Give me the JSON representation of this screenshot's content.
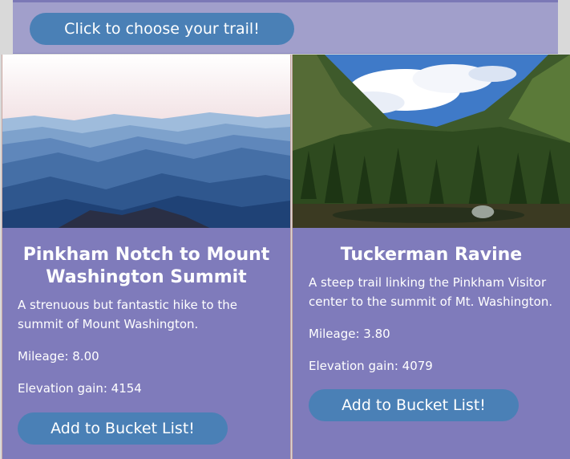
{
  "header": {
    "choose_button_label": "Click to choose your trail!"
  },
  "trails": [
    {
      "title": "Pinkham Notch to Mount Washington Summit",
      "description": "A strenuous but fantastic hike to the summit of Mount Washington.",
      "mileage": "Mileage: 8.00",
      "elevation": "Elevation gain: 4154",
      "button_label": "Add to Bucket List!",
      "image": "blue-mountain-ridges-photo"
    },
    {
      "title": "Tuckerman Ravine",
      "description": "A steep trail linking the Pinkham Visitor center to the summit of Mt. Washington.",
      "mileage": "Mileage: 3.80",
      "elevation": "Elevation gain: 4079",
      "button_label": "Add to Bucket List!",
      "image": "forested-ravine-photo"
    }
  ],
  "colors": {
    "page_background": "#d9d9d9",
    "header_background": "#a19fcb",
    "card_background": "#7f7bbb",
    "button_background": "#4a80b6",
    "text": "#ffffff"
  }
}
